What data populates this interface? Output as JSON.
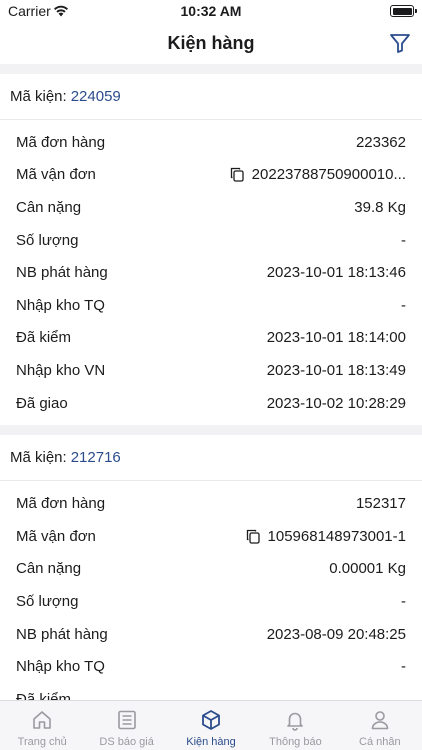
{
  "status": {
    "carrier": "Carrier",
    "time": "10:32 AM"
  },
  "header": {
    "title": "Kiện hàng"
  },
  "packages": [
    {
      "label": "Mã kiện:",
      "code": "224059",
      "fields": [
        {
          "key": "Mã đơn hàng",
          "value": "223362"
        },
        {
          "key": "Mã vận đơn",
          "value": "20223788750900010...",
          "copy": true
        },
        {
          "key": "Cân nặng",
          "value": "39.8 Kg"
        },
        {
          "key": "Số lượng",
          "value": "-"
        },
        {
          "key": "NB phát hàng",
          "value": "2023-10-01 18:13:46"
        },
        {
          "key": "Nhập kho TQ",
          "value": "-"
        },
        {
          "key": "Đã kiểm",
          "value": "2023-10-01 18:14:00"
        },
        {
          "key": "Nhập kho VN",
          "value": "2023-10-01 18:13:49"
        },
        {
          "key": "Đã giao",
          "value": "2023-10-02 10:28:29"
        }
      ]
    },
    {
      "label": "Mã kiện:",
      "code": "212716",
      "fields": [
        {
          "key": "Mã đơn hàng",
          "value": "152317"
        },
        {
          "key": "Mã vận đơn",
          "value": "105968148973001-1",
          "copy": true
        },
        {
          "key": "Cân nặng",
          "value": "0.00001 Kg"
        },
        {
          "key": "Số lượng",
          "value": "-"
        },
        {
          "key": "NB phát hàng",
          "value": "2023-08-09 20:48:25"
        },
        {
          "key": "Nhập kho TQ",
          "value": "-"
        },
        {
          "key": "Đã kiểm",
          "value": ""
        }
      ]
    }
  ],
  "tabs": [
    {
      "label": "Trang chủ",
      "icon": "home-icon"
    },
    {
      "label": "DS báo giá",
      "icon": "list-icon"
    },
    {
      "label": "Kiện hàng",
      "icon": "box-icon",
      "active": true
    },
    {
      "label": "Thông báo",
      "icon": "bell-icon"
    },
    {
      "label": "Cá nhân",
      "icon": "user-icon"
    }
  ],
  "colors": {
    "accent": "#2b4c8c",
    "inactive": "#9a9aa0",
    "background": "#f2f2f4"
  }
}
